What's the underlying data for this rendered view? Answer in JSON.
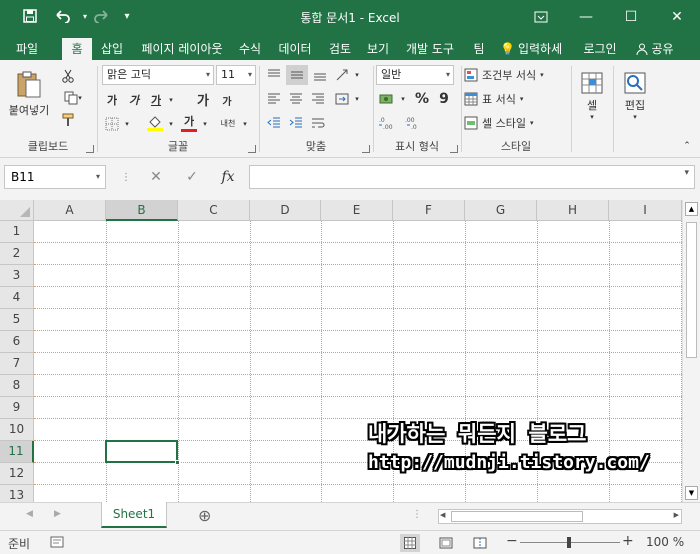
{
  "window": {
    "title": "통합 문서1  -  Excel",
    "minimize": "—",
    "maximize": "☐",
    "close": "✕"
  },
  "quick_access": {
    "save": "💾",
    "undo": "↶",
    "redo": "↷",
    "customize": "▾"
  },
  "ribbon_tabs": [
    "파일",
    "홈",
    "삽입",
    "페이지 레이아웃",
    "수식",
    "데이터",
    "검토",
    "보기",
    "개발 도구",
    "팀"
  ],
  "tell_me": "입력하세",
  "sign_in": "로그인",
  "share": "공유",
  "clipboard": {
    "paste": "붙여넣기",
    "label": "클립보드"
  },
  "font": {
    "name": "맑은 고딕",
    "size": "11",
    "bold": "가",
    "italic": "가",
    "underline": "가",
    "grow": "가",
    "shrink": "가",
    "font_color": "가",
    "phonetic": "내천",
    "label": "글꼴"
  },
  "alignment": {
    "label": "맞춤"
  },
  "number": {
    "format": "일반",
    "percent": "%",
    "comma": "9",
    "label": "표시 형식"
  },
  "styles": {
    "conditional": "조건부 서식",
    "table": "표 서식",
    "cell_styles": "셀 스타일",
    "label": "스타일"
  },
  "cells": {
    "label": "셀"
  },
  "editing": {
    "label": "편집"
  },
  "formula_bar": {
    "name_box": "B11",
    "cancel": "✕",
    "enter": "✓",
    "fx": "fx",
    "value": ""
  },
  "columns": [
    "A",
    "B",
    "C",
    "D",
    "E",
    "F",
    "G",
    "H",
    "I"
  ],
  "rows": [
    "1",
    "2",
    "3",
    "4",
    "5",
    "6",
    "7",
    "8",
    "9",
    "10",
    "11",
    "12",
    "13"
  ],
  "selected_cell": {
    "column": "B",
    "row": "11"
  },
  "sheets": [
    "Sheet1"
  ],
  "add_sheet": "⊕",
  "status": {
    "ready": "준비",
    "zoom": "100 %",
    "zoom_minus": "−",
    "zoom_plus": "+"
  },
  "watermark": {
    "line1": "내가하는 뭐든지 블로그",
    "line2": "http://mudnji.tistory.com/"
  },
  "colors": {
    "accent": "#217346",
    "gridline": "#d8a45c"
  }
}
